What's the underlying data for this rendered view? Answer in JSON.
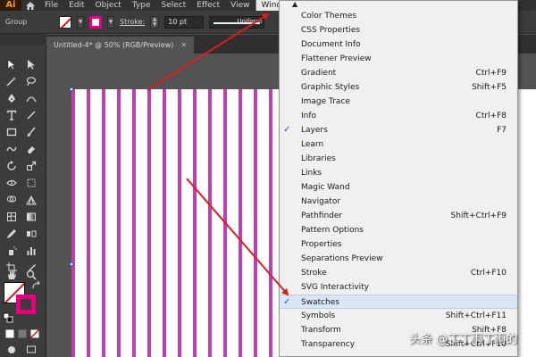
{
  "menubar": {
    "logo": "Ai",
    "items": [
      "File",
      "Edit",
      "Object",
      "Type",
      "Select",
      "Effect",
      "View",
      "Window"
    ]
  },
  "controlbar": {
    "selection_label": "Group",
    "stroke_label": "Stroke:",
    "stroke_weight": "10 pt",
    "stroke_profile": "Uniform"
  },
  "document": {
    "tab_title": "Untitled-4* @ 50% (RGB/Preview)",
    "close_glyph": "✕"
  },
  "window_menu": {
    "scroll_glyph": "▲",
    "check_glyph": "✓",
    "items": [
      {
        "label": "Color Themes",
        "shortcut": "",
        "checked": false
      },
      {
        "label": "CSS Properties",
        "shortcut": "",
        "checked": false
      },
      {
        "label": "Document Info",
        "shortcut": "",
        "checked": false
      },
      {
        "label": "Flattener Preview",
        "shortcut": "",
        "checked": false
      },
      {
        "label": "Gradient",
        "shortcut": "Ctrl+F9",
        "checked": false
      },
      {
        "label": "Graphic Styles",
        "shortcut": "Shift+F5",
        "checked": false
      },
      {
        "label": "Image Trace",
        "shortcut": "",
        "checked": false
      },
      {
        "label": "Info",
        "shortcut": "Ctrl+F8",
        "checked": false
      },
      {
        "label": "Layers",
        "shortcut": "F7",
        "checked": true
      },
      {
        "label": "Learn",
        "shortcut": "",
        "checked": false
      },
      {
        "label": "Libraries",
        "shortcut": "",
        "checked": false
      },
      {
        "label": "Links",
        "shortcut": "",
        "checked": false
      },
      {
        "label": "Magic Wand",
        "shortcut": "",
        "checked": false
      },
      {
        "label": "Navigator",
        "shortcut": "",
        "checked": false
      },
      {
        "label": "Pathfinder",
        "shortcut": "Shift+Ctrl+F9",
        "checked": false
      },
      {
        "label": "Pattern Options",
        "shortcut": "",
        "checked": false
      },
      {
        "label": "Properties",
        "shortcut": "",
        "checked": false
      },
      {
        "label": "Separations Preview",
        "shortcut": "",
        "checked": false
      },
      {
        "label": "Stroke",
        "shortcut": "Ctrl+F10",
        "checked": false
      },
      {
        "label": "SVG Interactivity",
        "shortcut": "",
        "checked": false
      },
      {
        "label": "Swatches",
        "shortcut": "",
        "checked": true,
        "highlighted": true
      },
      {
        "label": "Symbols",
        "shortcut": "Shift+Ctrl+F11",
        "checked": false
      },
      {
        "label": "Transform",
        "shortcut": "Shift+F8",
        "checked": false
      },
      {
        "label": "Transparency",
        "shortcut": "Shift+Ctrl+F10",
        "checked": false
      }
    ]
  },
  "colors": {
    "stripe": "#c03fb0",
    "stroke_swatch": "#e6007e",
    "annotation_arrow": "#d81e1e",
    "menu_highlight": "#dbe6f5"
  },
  "watermark": "头条 @丁丁雨丁雨的"
}
